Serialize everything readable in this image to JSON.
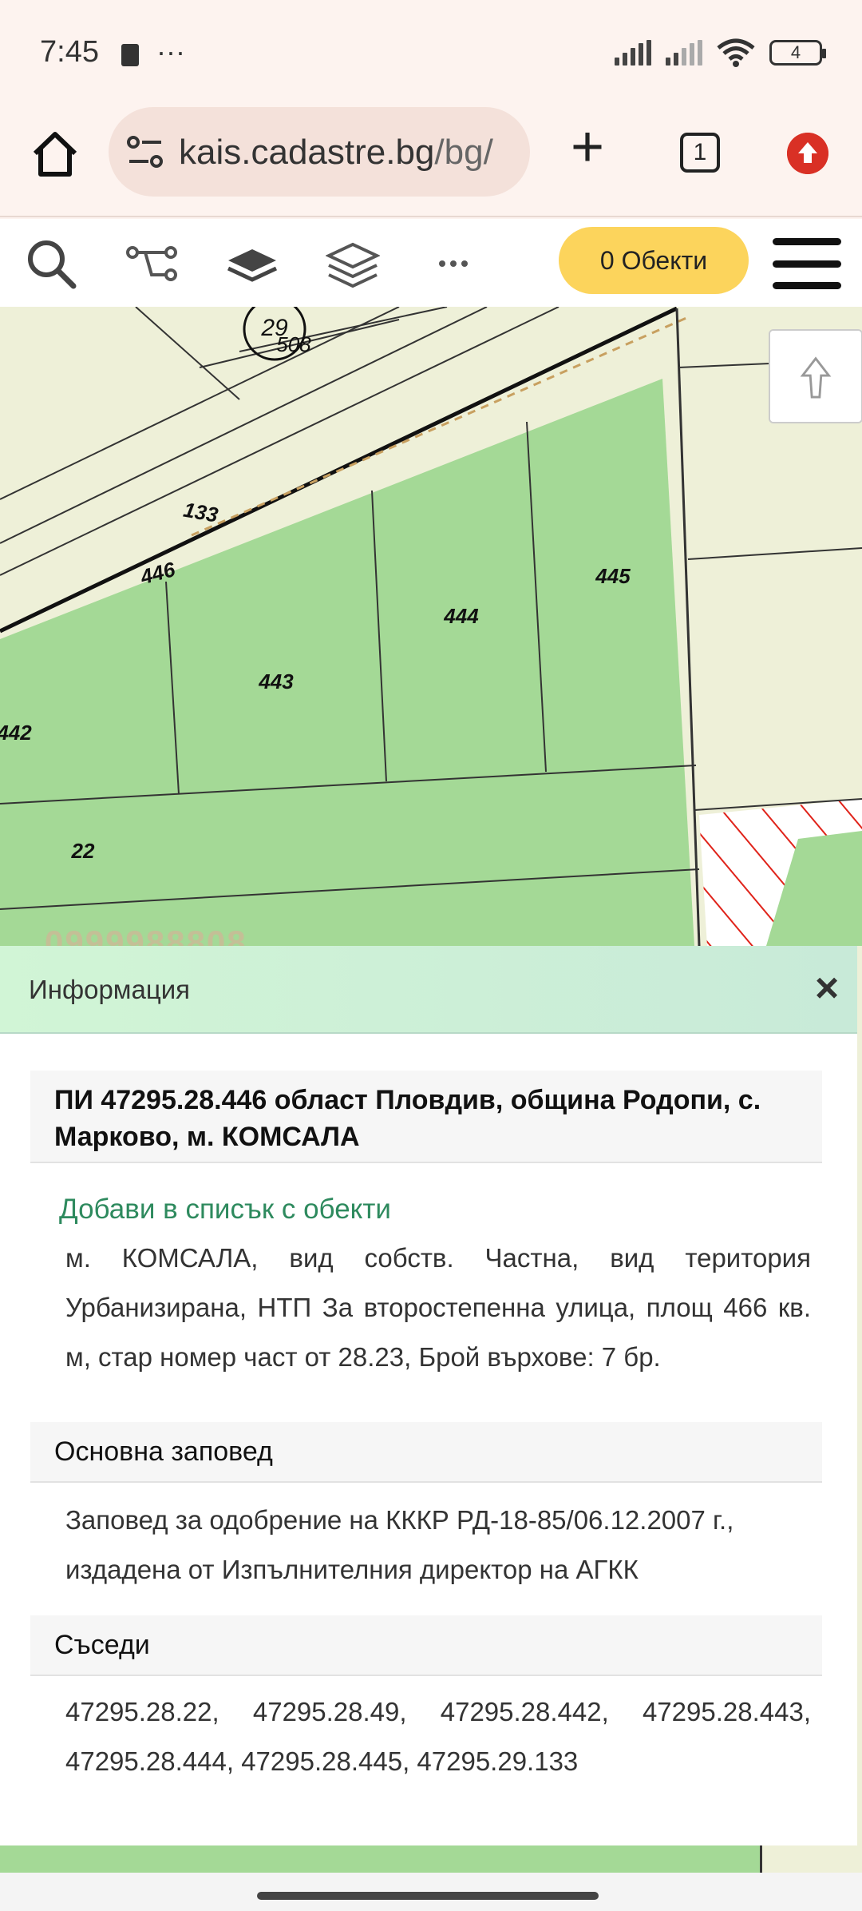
{
  "status_bar": {
    "time": "7:45",
    "dots": "···",
    "battery": "4"
  },
  "browser": {
    "url_host": "kais.cadastre.bg",
    "url_path": "/bg/",
    "tab_count": "1"
  },
  "toolbar": {
    "objects_label": "0 Обекти"
  },
  "map": {
    "labels": {
      "l29": "29",
      "l508": "508",
      "l133": "133",
      "l446": "446",
      "l445": "445",
      "l444": "444",
      "l443": "443",
      "l442": "442",
      "l22": "22"
    },
    "watermark": "0999988808"
  },
  "info": {
    "title": "Информация",
    "parcel_heading": "ПИ 47295.28.446 област Пловдив, община Родопи, с. Марково, м. КОМСАЛА",
    "add_link": "Добави в списък с обекти",
    "description": "м. КОМСАЛА, вид собств. Частна, вид територия Урбанизирана, НТП За второстепенна улица, площ 466 кв. м, стар номер част от 28.23, Брой върхове: 7 бр.",
    "order_heading": "Основна заповед",
    "order_text": "Заповед за одобрение на КККР РД-18-85/06.12.2007 г., издадена от Изпълнителния директор на АГКК",
    "neighbors_heading": "Съседи",
    "neighbors_text": "47295.28.22, 47295.28.49, 47295.28.442, 47295.28.443, 47295.28.444, 47295.28.445, 47295.29.133"
  },
  "colors": {
    "parcel_green": "#a4d996",
    "map_bg": "#eef0d8",
    "accent_yellow": "#fcd45c",
    "link_green": "#2e8a5e",
    "hatch_red": "#e0231a"
  }
}
